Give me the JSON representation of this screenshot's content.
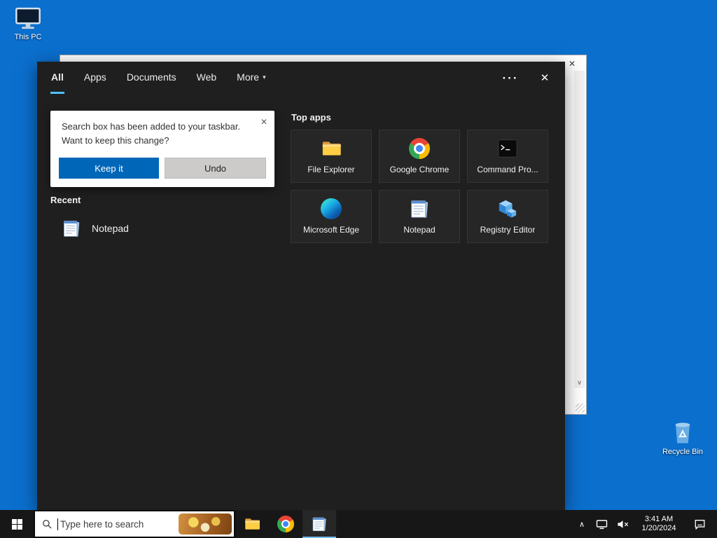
{
  "colors": {
    "desktop_bg": "#0B6FCE",
    "panel_bg": "#1F1F1F",
    "taskbar_bg": "#171717",
    "accent": "#0067B8",
    "tab_underline": "#4CC2FF",
    "tile_bg": "#262626",
    "taskbar_active": "#76B9ED"
  },
  "icons": {
    "close": "✕",
    "ellipsis": "···",
    "chevron_down": "▾",
    "tray_chevron": "∧",
    "scroll_down": "∨"
  },
  "desktop": {
    "this_pc_label": "This PC",
    "recycle_bin_label": "Recycle Bin"
  },
  "search_panel": {
    "tabs": [
      {
        "label": "All"
      },
      {
        "label": "Apps"
      },
      {
        "label": "Documents"
      },
      {
        "label": "Web"
      },
      {
        "label": "More"
      }
    ],
    "notification": {
      "line1": "Search box has been added to your taskbar.",
      "line2": "Want to keep this change?",
      "keep_button": "Keep it",
      "undo_button": "Undo"
    },
    "recent_header": "Recent",
    "recent_items": [
      {
        "label": "Notepad",
        "icon": "notepad-icon"
      }
    ],
    "top_apps_header": "Top apps",
    "top_apps": [
      {
        "label": "File Explorer",
        "icon": "file-explorer-icon"
      },
      {
        "label": "Google Chrome",
        "icon": "chrome-icon"
      },
      {
        "label": "Command Pro...",
        "icon": "command-prompt-icon"
      },
      {
        "label": "Microsoft Edge",
        "icon": "edge-icon"
      },
      {
        "label": "Notepad",
        "icon": "notepad-icon"
      },
      {
        "label": "Registry Editor",
        "icon": "registry-editor-icon"
      }
    ]
  },
  "taskbar": {
    "search_placeholder": "Type here to search",
    "clock_time": "3:41 AM",
    "clock_date": "1/20/2024"
  }
}
